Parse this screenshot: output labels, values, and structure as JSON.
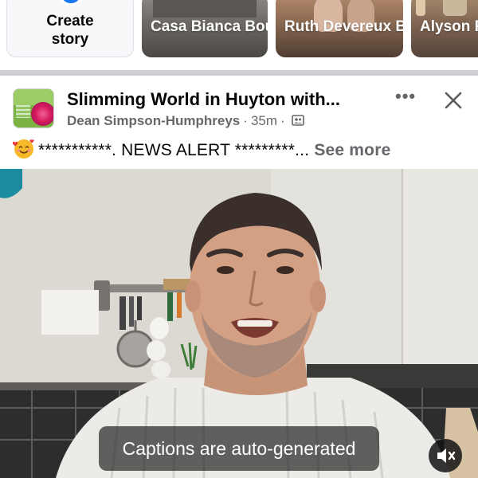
{
  "stories": {
    "create": {
      "label_line1": "Create",
      "label_line2": "story",
      "icon": "plus-icon"
    },
    "items": [
      {
        "name": "Casa Bianca Boutique H..."
      },
      {
        "name": "Ruth Devereux B..."
      },
      {
        "name": "Alyson Rochfor"
      }
    ]
  },
  "post": {
    "group_title": "Slimming World in Huyton with...",
    "author": "Dean Simpson-Humphreys",
    "time": "35m",
    "separator": "·",
    "audience_icon": "group-members-icon",
    "more_label": "•••",
    "close_icon": "close-icon",
    "emoji": "smiling-face-with-hearts",
    "text": "***********. NEWS ALERT *********...",
    "see_more": "See more"
  },
  "video": {
    "caption": "Captions are auto-generated",
    "mute_icon": "speaker-muted-icon"
  },
  "colors": {
    "facebook_blue": "#1877f2",
    "secondary_text": "#65676b",
    "divider": "#ced0d4"
  }
}
